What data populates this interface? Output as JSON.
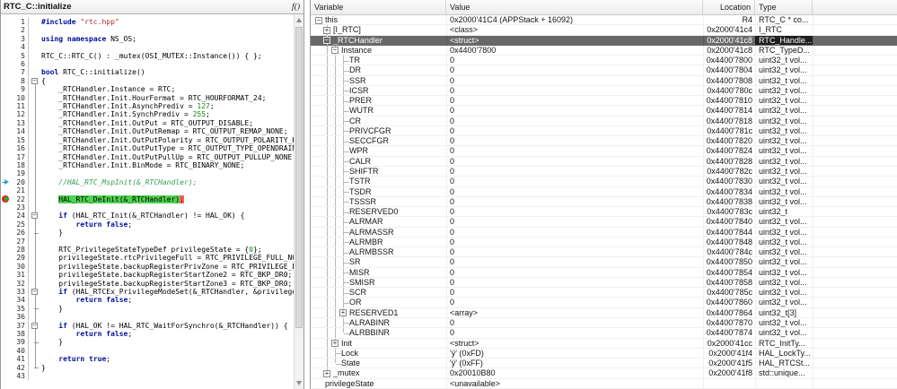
{
  "editor": {
    "title": "RTC_C::initialize",
    "fn_icon": "f()",
    "gutter_icons": {
      "20": "flow-arrow-icon",
      "22": "breakpoint-current-icon"
    },
    "fold_opens": [
      8,
      24,
      33,
      37
    ],
    "fold_closes": [
      26,
      35,
      39,
      42
    ],
    "fold_span": [
      8,
      42
    ],
    "lines": [
      {
        "n": 1,
        "segs": [
          [
            "k",
            "#include"
          ],
          [
            "p",
            " "
          ],
          [
            "s",
            "\"rtc.hpp\""
          ]
        ]
      },
      {
        "n": 2,
        "segs": []
      },
      {
        "n": 3,
        "segs": [
          [
            "k",
            "using"
          ],
          [
            "p",
            " "
          ],
          [
            "k",
            "namespace"
          ],
          [
            "p",
            " NS_OS;"
          ]
        ]
      },
      {
        "n": 4,
        "segs": []
      },
      {
        "n": 5,
        "segs": [
          [
            "p",
            "RTC_C::RTC_C() : _mutex(OSI_MUTEX::Instance()) { };"
          ]
        ]
      },
      {
        "n": 6,
        "segs": []
      },
      {
        "n": 7,
        "segs": [
          [
            "k",
            "bool"
          ],
          [
            "p",
            " RTC_C::initialize()"
          ]
        ]
      },
      {
        "n": 8,
        "segs": [
          [
            "p",
            "{"
          ]
        ]
      },
      {
        "n": 9,
        "segs": [
          [
            "p",
            "    _RTCHandler.Instance = RTC;"
          ]
        ]
      },
      {
        "n": 10,
        "segs": [
          [
            "p",
            "    _RTCHandler.Init.HourFormat = RTC_HOURFORMAT_24;"
          ]
        ]
      },
      {
        "n": 11,
        "segs": [
          [
            "p",
            "    _RTCHandler.Init.AsynchPrediv = "
          ],
          [
            "n",
            "127"
          ],
          [
            "p",
            ";"
          ]
        ]
      },
      {
        "n": 12,
        "segs": [
          [
            "p",
            "    _RTCHandler.Init.SynchPrediv = "
          ],
          [
            "n",
            "255"
          ],
          [
            "p",
            ";"
          ]
        ]
      },
      {
        "n": 13,
        "segs": [
          [
            "p",
            "    _RTCHandler.Init.OutPut = RTC_OUTPUT_DISABLE;"
          ]
        ]
      },
      {
        "n": 14,
        "segs": [
          [
            "p",
            "    _RTCHandler.Init.OutPutRemap = RTC_OUTPUT_REMAP_NONE;"
          ]
        ]
      },
      {
        "n": 15,
        "segs": [
          [
            "p",
            "    _RTCHandler.Init.OutPutPolarity = RTC_OUTPUT_POLARITY_HIGH;"
          ]
        ]
      },
      {
        "n": 16,
        "segs": [
          [
            "p",
            "    _RTCHandler.Init.OutPutType = RTC_OUTPUT_TYPE_OPENDRAIN;"
          ]
        ]
      },
      {
        "n": 17,
        "segs": [
          [
            "p",
            "    _RTCHandler.Init.OutPutPullUp = RTC_OUTPUT_PULLUP_NONE;"
          ]
        ]
      },
      {
        "n": 18,
        "segs": [
          [
            "p",
            "    _RTCHandler.Init.BinMode = RTC_BINARY_NONE;"
          ]
        ]
      },
      {
        "n": 19,
        "segs": []
      },
      {
        "n": 20,
        "segs": [
          [
            "c",
            "    //HAL_RTC_MspInit(&_RTCHandler);"
          ]
        ]
      },
      {
        "n": 21,
        "segs": []
      },
      {
        "n": 22,
        "segs": [
          [
            "p",
            "    "
          ],
          [
            "hg",
            "HAL_RTC_DeInit(&_RTCHandler)"
          ],
          [
            "hr",
            ";"
          ]
        ]
      },
      {
        "n": 23,
        "segs": []
      },
      {
        "n": 24,
        "segs": [
          [
            "p",
            "    "
          ],
          [
            "k",
            "if"
          ],
          [
            "p",
            " (HAL_RTC_Init(&_RTCHandler) != HAL_OK) {"
          ]
        ]
      },
      {
        "n": 25,
        "segs": [
          [
            "p",
            "        "
          ],
          [
            "k",
            "return"
          ],
          [
            "p",
            " "
          ],
          [
            "k",
            "false"
          ],
          [
            "p",
            ";"
          ]
        ]
      },
      {
        "n": 26,
        "segs": [
          [
            "p",
            "    }"
          ]
        ]
      },
      {
        "n": 27,
        "segs": []
      },
      {
        "n": 28,
        "segs": [
          [
            "p",
            "    RTC_PrivilegeStateTypeDef privilegeState = {"
          ],
          [
            "n",
            "0"
          ],
          [
            "p",
            "};"
          ]
        ]
      },
      {
        "n": 29,
        "segs": [
          [
            "p",
            "    privilegeState.rtcPrivilegeFull = RTC_PRIVILEGE_FULL_NO;"
          ]
        ]
      },
      {
        "n": 30,
        "segs": [
          [
            "p",
            "    privilegeState.backupRegisterPrivZone = RTC_PRIVILEGE_BKUP"
          ]
        ]
      },
      {
        "n": 31,
        "segs": [
          [
            "p",
            "    privilegeState.backupRegisterStartZone2 = RTC_BKP_DR0;"
          ]
        ]
      },
      {
        "n": 32,
        "segs": [
          [
            "p",
            "    privilegeState.backupRegisterStartZone3 = RTC_BKP_DR0;"
          ]
        ]
      },
      {
        "n": 33,
        "segs": [
          [
            "p",
            "    "
          ],
          [
            "k",
            "if"
          ],
          [
            "p",
            " (HAL_RTCEx_PrivilegeModeSet(&_RTCHandler, &privilegeSta"
          ]
        ]
      },
      {
        "n": 34,
        "segs": [
          [
            "p",
            "        "
          ],
          [
            "k",
            "return"
          ],
          [
            "p",
            " "
          ],
          [
            "k",
            "false"
          ],
          [
            "p",
            ";"
          ]
        ]
      },
      {
        "n": 35,
        "segs": [
          [
            "p",
            "    }"
          ]
        ]
      },
      {
        "n": 36,
        "segs": []
      },
      {
        "n": 37,
        "segs": [
          [
            "p",
            "    "
          ],
          [
            "k",
            "if"
          ],
          [
            "p",
            " (HAL_OK != HAL_RTC_WaitForSynchro(&_RTCHandler)) {"
          ]
        ]
      },
      {
        "n": 38,
        "segs": [
          [
            "p",
            "        "
          ],
          [
            "k",
            "return"
          ],
          [
            "p",
            " "
          ],
          [
            "k",
            "false"
          ],
          [
            "p",
            ";"
          ]
        ]
      },
      {
        "n": 39,
        "segs": [
          [
            "p",
            "    }"
          ]
        ]
      },
      {
        "n": 40,
        "segs": []
      },
      {
        "n": 41,
        "segs": [
          [
            "p",
            "    "
          ],
          [
            "k",
            "return"
          ],
          [
            "p",
            " "
          ],
          [
            "k",
            "true"
          ],
          [
            "p",
            ";"
          ]
        ]
      },
      {
        "n": 42,
        "segs": [
          [
            "p",
            "}"
          ]
        ]
      },
      {
        "n": 43,
        "segs": []
      }
    ]
  },
  "watch": {
    "columns": [
      "Variable",
      "Value",
      "Location",
      "Type"
    ],
    "rows": [
      {
        "name": "this",
        "value": "0x2000'41C4 (APPStack + 16092)",
        "loc": "R4",
        "type": "RTC_C * co...",
        "lvl": 0,
        "g": [],
        "exp": "-",
        "last": false,
        "sel": false
      },
      {
        "name": "[I_RTC]",
        "value": "<class>",
        "loc": "0x2000'41c4",
        "type": "I_RTC",
        "lvl": 1,
        "g": [
          1
        ],
        "exp": "+",
        "last": false,
        "sel": false
      },
      {
        "name": "_RTCHandler",
        "value": "<struct>",
        "loc": "0x2000'41c8",
        "type": "RTC_Handle...",
        "lvl": 1,
        "g": [
          1
        ],
        "exp": "-",
        "last": false,
        "sel": true
      },
      {
        "name": "Instance",
        "value": "0x4400'7800",
        "loc": "0x2000'41c8",
        "type": "RTC_TypeD...",
        "lvl": 2,
        "g": [
          1,
          2
        ],
        "exp": "-",
        "last": false,
        "sel": false
      },
      {
        "name": "TR",
        "value": "0",
        "loc": "0x4400'7800",
        "type": "uint32_t vol...",
        "lvl": 3,
        "g": [
          1,
          2,
          3
        ],
        "exp": null,
        "last": false,
        "sel": false
      },
      {
        "name": "DR",
        "value": "0",
        "loc": "0x4400'7804",
        "type": "uint32_t vol...",
        "lvl": 3,
        "g": [
          1,
          2,
          3
        ],
        "exp": null,
        "last": false,
        "sel": false
      },
      {
        "name": "SSR",
        "value": "0",
        "loc": "0x4400'7808",
        "type": "uint32_t vol...",
        "lvl": 3,
        "g": [
          1,
          2,
          3
        ],
        "exp": null,
        "last": false,
        "sel": false
      },
      {
        "name": "ICSR",
        "value": "0",
        "loc": "0x4400'780c",
        "type": "uint32_t vol...",
        "lvl": 3,
        "g": [
          1,
          2,
          3
        ],
        "exp": null,
        "last": false,
        "sel": false
      },
      {
        "name": "PRER",
        "value": "0",
        "loc": "0x4400'7810",
        "type": "uint32_t vol...",
        "lvl": 3,
        "g": [
          1,
          2,
          3
        ],
        "exp": null,
        "last": false,
        "sel": false
      },
      {
        "name": "WUTR",
        "value": "0",
        "loc": "0x4400'7814",
        "type": "uint32_t vol...",
        "lvl": 3,
        "g": [
          1,
          2,
          3
        ],
        "exp": null,
        "last": false,
        "sel": false
      },
      {
        "name": "CR",
        "value": "0",
        "loc": "0x4400'7818",
        "type": "uint32_t vol...",
        "lvl": 3,
        "g": [
          1,
          2,
          3
        ],
        "exp": null,
        "last": false,
        "sel": false
      },
      {
        "name": "PRIVCFGR",
        "value": "0",
        "loc": "0x4400'781c",
        "type": "uint32_t vol...",
        "lvl": 3,
        "g": [
          1,
          2,
          3
        ],
        "exp": null,
        "last": false,
        "sel": false
      },
      {
        "name": "SECCFGR",
        "value": "0",
        "loc": "0x4400'7820",
        "type": "uint32_t vol...",
        "lvl": 3,
        "g": [
          1,
          2,
          3
        ],
        "exp": null,
        "last": false,
        "sel": false
      },
      {
        "name": "WPR",
        "value": "0",
        "loc": "0x4400'7824",
        "type": "uint32_t vol...",
        "lvl": 3,
        "g": [
          1,
          2,
          3
        ],
        "exp": null,
        "last": false,
        "sel": false
      },
      {
        "name": "CALR",
        "value": "0",
        "loc": "0x4400'7828",
        "type": "uint32_t vol...",
        "lvl": 3,
        "g": [
          1,
          2,
          3
        ],
        "exp": null,
        "last": false,
        "sel": false
      },
      {
        "name": "SHIFTR",
        "value": "0",
        "loc": "0x4400'782c",
        "type": "uint32_t vol...",
        "lvl": 3,
        "g": [
          1,
          2,
          3
        ],
        "exp": null,
        "last": false,
        "sel": false
      },
      {
        "name": "TSTR",
        "value": "0",
        "loc": "0x4400'7830",
        "type": "uint32_t vol...",
        "lvl": 3,
        "g": [
          1,
          2,
          3
        ],
        "exp": null,
        "last": false,
        "sel": false
      },
      {
        "name": "TSDR",
        "value": "0",
        "loc": "0x4400'7834",
        "type": "uint32_t vol...",
        "lvl": 3,
        "g": [
          1,
          2,
          3
        ],
        "exp": null,
        "last": false,
        "sel": false
      },
      {
        "name": "TSSSR",
        "value": "0",
        "loc": "0x4400'7838",
        "type": "uint32_t vol...",
        "lvl": 3,
        "g": [
          1,
          2,
          3
        ],
        "exp": null,
        "last": false,
        "sel": false
      },
      {
        "name": "RESERVED0",
        "value": "0",
        "loc": "0x4400'783c",
        "type": "uint32_t",
        "lvl": 3,
        "g": [
          1,
          2,
          3
        ],
        "exp": null,
        "last": false,
        "sel": false
      },
      {
        "name": "ALRMAR",
        "value": "0",
        "loc": "0x4400'7840",
        "type": "uint32_t vol...",
        "lvl": 3,
        "g": [
          1,
          2,
          3
        ],
        "exp": null,
        "last": false,
        "sel": false
      },
      {
        "name": "ALRMASSR",
        "value": "0",
        "loc": "0x4400'7844",
        "type": "uint32_t vol...",
        "lvl": 3,
        "g": [
          1,
          2,
          3
        ],
        "exp": null,
        "last": false,
        "sel": false
      },
      {
        "name": "ALRMBR",
        "value": "0",
        "loc": "0x4400'7848",
        "type": "uint32_t vol...",
        "lvl": 3,
        "g": [
          1,
          2,
          3
        ],
        "exp": null,
        "last": false,
        "sel": false
      },
      {
        "name": "ALRMBSSR",
        "value": "0",
        "loc": "0x4400'784c",
        "type": "uint32_t vol...",
        "lvl": 3,
        "g": [
          1,
          2,
          3
        ],
        "exp": null,
        "last": false,
        "sel": false
      },
      {
        "name": "SR",
        "value": "0",
        "loc": "0x4400'7850",
        "type": "uint32_t vol...",
        "lvl": 3,
        "g": [
          1,
          2,
          3
        ],
        "exp": null,
        "last": false,
        "sel": false
      },
      {
        "name": "MISR",
        "value": "0",
        "loc": "0x4400'7854",
        "type": "uint32_t vol...",
        "lvl": 3,
        "g": [
          1,
          2,
          3
        ],
        "exp": null,
        "last": false,
        "sel": false
      },
      {
        "name": "SMISR",
        "value": "0",
        "loc": "0x4400'7858",
        "type": "uint32_t vol...",
        "lvl": 3,
        "g": [
          1,
          2,
          3
        ],
        "exp": null,
        "last": false,
        "sel": false
      },
      {
        "name": "SCR",
        "value": "0",
        "loc": "0x4400'785c",
        "type": "uint32_t vol...",
        "lvl": 3,
        "g": [
          1,
          2,
          3
        ],
        "exp": null,
        "last": false,
        "sel": false
      },
      {
        "name": "OR",
        "value": "0",
        "loc": "0x4400'7860",
        "type": "uint32_t vol...",
        "lvl": 3,
        "g": [
          1,
          2,
          3
        ],
        "exp": null,
        "last": false,
        "sel": false
      },
      {
        "name": "RESERVED1",
        "value": "<array>",
        "loc": "0x4400'7864",
        "type": "uint32_t[3]",
        "lvl": 3,
        "g": [
          1,
          2,
          3
        ],
        "exp": "+",
        "last": false,
        "sel": false
      },
      {
        "name": "ALRABINR",
        "value": "0",
        "loc": "0x4400'7870",
        "type": "uint32_t vol...",
        "lvl": 3,
        "g": [
          1,
          2,
          3
        ],
        "exp": null,
        "last": false,
        "sel": false
      },
      {
        "name": "ALRBBINR",
        "value": "0",
        "loc": "0x4400'7874",
        "type": "uint32_t vol...",
        "lvl": 3,
        "g": [
          1,
          2,
          3
        ],
        "exp": null,
        "last": true,
        "sel": false
      },
      {
        "name": "Init",
        "value": "<struct>",
        "loc": "0x2000'41cc",
        "type": "RTC_InitTy...",
        "lvl": 2,
        "g": [
          1,
          2
        ],
        "exp": "+",
        "last": false,
        "sel": false
      },
      {
        "name": "Lock",
        "value": "'ý' (0xFD)",
        "loc": "0x2000'41f4",
        "type": "HAL_LockTy...",
        "lvl": 2,
        "g": [
          1,
          2
        ],
        "exp": null,
        "last": false,
        "sel": false
      },
      {
        "name": "State",
        "value": "'ÿ' (0xFF)",
        "loc": "0x2000'41f5",
        "type": "HAL_RTCSt...",
        "lvl": 2,
        "g": [
          1,
          2
        ],
        "exp": null,
        "last": true,
        "sel": false
      },
      {
        "name": "_mutex",
        "value": "0x20010B80",
        "loc": "0x2000'41f8",
        "type": "std::unique...",
        "lvl": 1,
        "g": [
          1
        ],
        "exp": "+",
        "last": true,
        "sel": false
      },
      {
        "name": "privilegeState",
        "value": "<unavailable>",
        "loc": "",
        "type": "",
        "lvl": 0,
        "g": [],
        "exp": null,
        "last": false,
        "sel": false
      }
    ]
  },
  "colors": {
    "selection_bg": "#686868",
    "selection_type_bg": "#1f1f1f",
    "exec_highlight_green": "#4fd24f",
    "exec_highlight_red": "#f4645c",
    "breakpoint_red": "#da251c",
    "flow_arrow_teal": "#2aa7c9",
    "keyword_blue": "#00109b",
    "string_maroon": "#9e2a2a",
    "number_green": "#098f09",
    "comment_green": "#2f9e4f"
  }
}
